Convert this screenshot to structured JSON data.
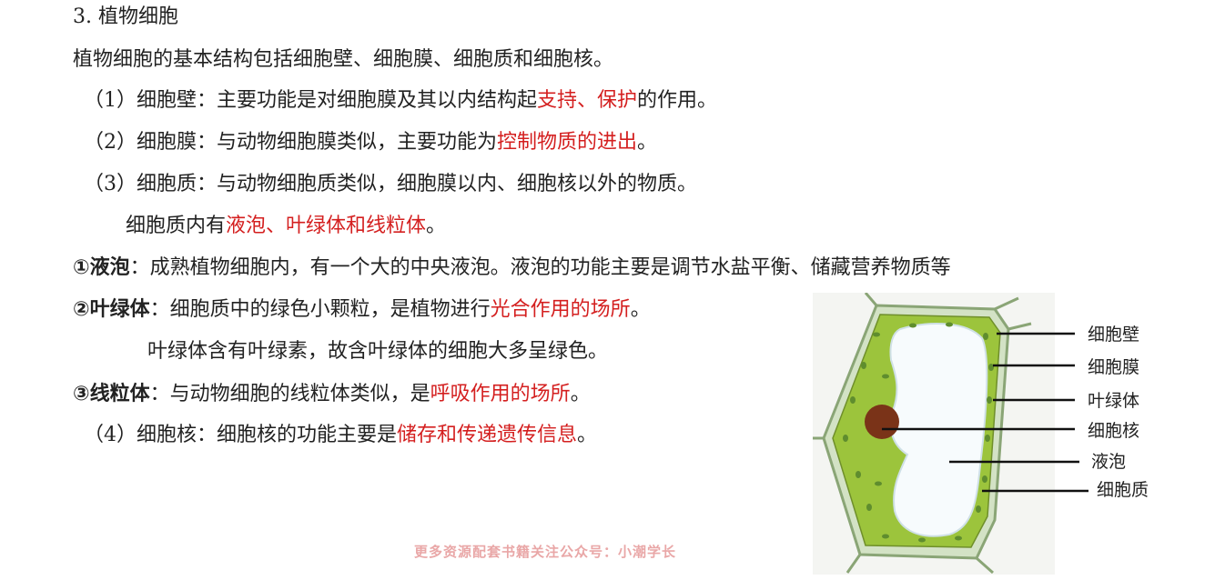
{
  "heading": {
    "num": "3.",
    "title": "植物细胞"
  },
  "intro": "植物细胞的基本结构包括细胞壁、细胞膜、细胞质和细胞核。",
  "wall": {
    "num": "（1）",
    "a": "细胞壁：主要功能是对细胞膜及其以内结构起",
    "red": "支持、保护",
    "b": "的作用。"
  },
  "membrane": {
    "num": "（2）",
    "a": "细胞膜：与动物细胞膜类似，主要功能为",
    "red": "控制物质的进出",
    "b": "。"
  },
  "cytoplasm": {
    "num": "（3）",
    "a": "细胞质：与动物细胞质类似，细胞膜以内、细胞核以外的物质。"
  },
  "organelles": {
    "a": "细胞质内有",
    "red": "液泡、叶绿体和线粒体",
    "b": "。"
  },
  "vacuole": {
    "marker": "①",
    "term": "液泡",
    "text": "：成熟植物细胞内，有一个大的中央液泡。液泡的功能主要是调节水盐平衡、储藏营养物质等"
  },
  "chloroplast": {
    "marker": "②",
    "term": "叶绿体",
    "a": "：细胞质中的绿色小颗粒，是植物进行",
    "red": "光合作用的场所",
    "b": "。"
  },
  "chloroplast_note": "叶绿体含有叶绿素，故含叶绿体的细胞大多呈绿色。",
  "mitochondria": {
    "marker": "③",
    "term": "线粒体",
    "a": "：与动物细胞的线粒体类似，是",
    "red": "呼吸作用的场所",
    "b": "。"
  },
  "nucleus": {
    "num": "（4）",
    "a": "细胞核：细胞核的功能主要是",
    "red": "储存和传递遗传信息",
    "b": "。"
  },
  "diagram_labels": {
    "wall": "细胞壁",
    "membrane": "细胞膜",
    "chloroplast": "叶绿体",
    "nucleus": "细胞核",
    "vacuole": "液泡",
    "cytoplasm": "细胞质"
  },
  "watermark": "更多资源配套书籍关注公众号：小潮学长",
  "colors": {
    "accent_red": "#d41f1f",
    "cell_green": "#9cc43c",
    "wall_green": "#c9dcb8",
    "nucleus_brown": "#7a3318"
  }
}
